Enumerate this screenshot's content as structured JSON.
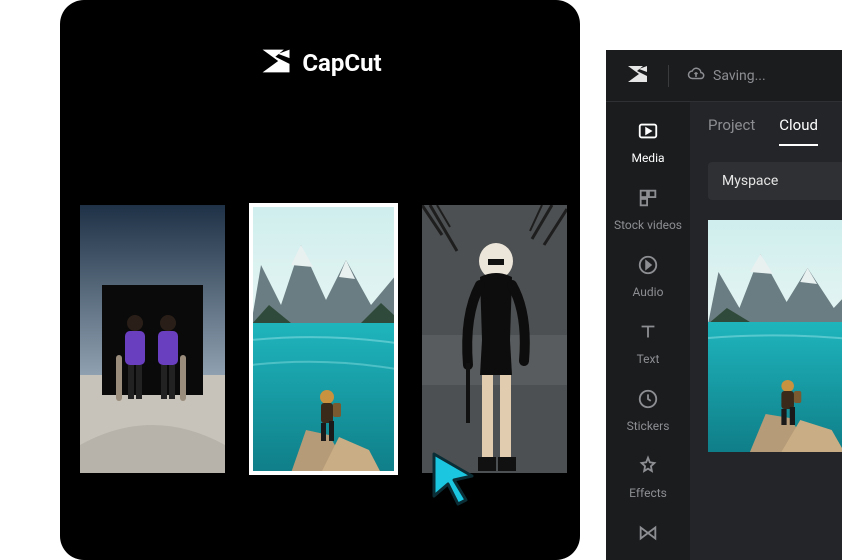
{
  "brand": {
    "name": "CapCut"
  },
  "gallery": {
    "thumbs": [
      {
        "name": "thumb-people"
      },
      {
        "name": "thumb-lake",
        "selected": true
      },
      {
        "name": "thumb-model"
      }
    ]
  },
  "editor": {
    "status": {
      "label": "Saving..."
    },
    "sidebar": {
      "items": [
        {
          "key": "media",
          "label": "Media",
          "icon": "media-icon",
          "active": true
        },
        {
          "key": "stock",
          "label": "Stock videos",
          "icon": "stock-icon"
        },
        {
          "key": "audio",
          "label": "Audio",
          "icon": "audio-icon"
        },
        {
          "key": "text",
          "label": "Text",
          "icon": "text-icon"
        },
        {
          "key": "stickers",
          "label": "Stickers",
          "icon": "stickers-icon"
        },
        {
          "key": "effects",
          "label": "Effects",
          "icon": "effects-icon"
        },
        {
          "key": "transition",
          "label": "Transition",
          "icon": "transition-icon"
        }
      ]
    },
    "tabs": [
      {
        "key": "project",
        "label": "Project"
      },
      {
        "key": "cloud",
        "label": "Cloud",
        "active": true
      }
    ],
    "folder": {
      "name": "Myspace"
    }
  }
}
